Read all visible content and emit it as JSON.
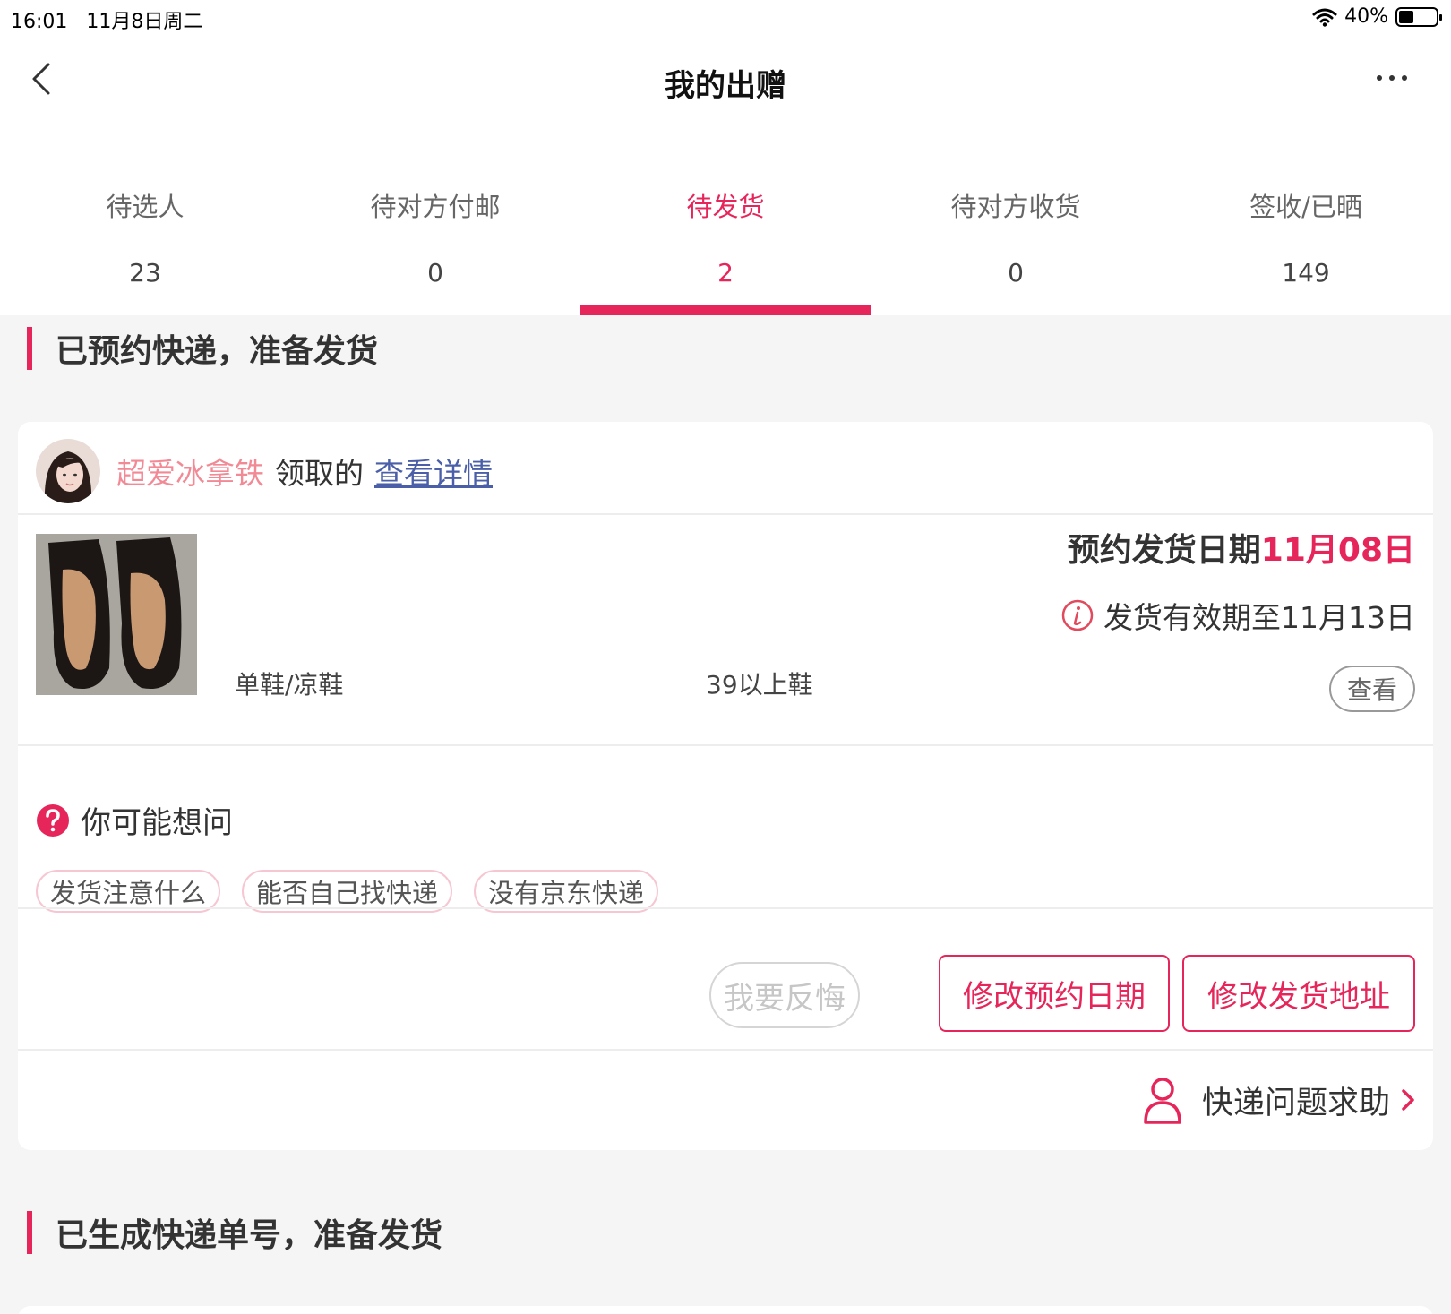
{
  "status_bar": {
    "time": "16:01",
    "date": "11月8日周二",
    "battery": "40%",
    "battery_level": 0.4
  },
  "nav": {
    "title": "我的出赠",
    "back_icon": "chevron-left-icon",
    "more_icon": "more-dots-icon"
  },
  "tabs": [
    {
      "label": "待选人",
      "count": "23",
      "active": false
    },
    {
      "label": "待对方付邮",
      "count": "0",
      "active": false
    },
    {
      "label": "待发货",
      "count": "2",
      "active": true
    },
    {
      "label": "待对方收货",
      "count": "0",
      "active": false
    },
    {
      "label": "签收/已晒",
      "count": "149",
      "active": false
    }
  ],
  "section1": {
    "title": "已预约快递，准备发货"
  },
  "order": {
    "claimer": "超爱冰拿铁",
    "claim_text": "领取的",
    "detail_link": "查看详情",
    "category": "单鞋/凉鞋",
    "size": "39以上鞋",
    "ship_date_label": "预约发货日期",
    "ship_date": "11月08日",
    "valid_until": "发货有效期至11月13日",
    "view_button": "查看",
    "ask_title": "你可能想问",
    "faq_chips": [
      "发货注意什么",
      "能否自己找快递",
      "没有京东快递"
    ],
    "regret_button": "我要反悔",
    "modify_date_button": "修改预约日期",
    "modify_address_button": "修改发货地址",
    "help_text": "快递问题求助"
  },
  "section2": {
    "title": "已生成快递单号，准备发货"
  },
  "colors": {
    "accent": "#e6265a",
    "claimer": "#f28a96",
    "link": "#4a5fa8",
    "background": "#f5f5f5"
  }
}
